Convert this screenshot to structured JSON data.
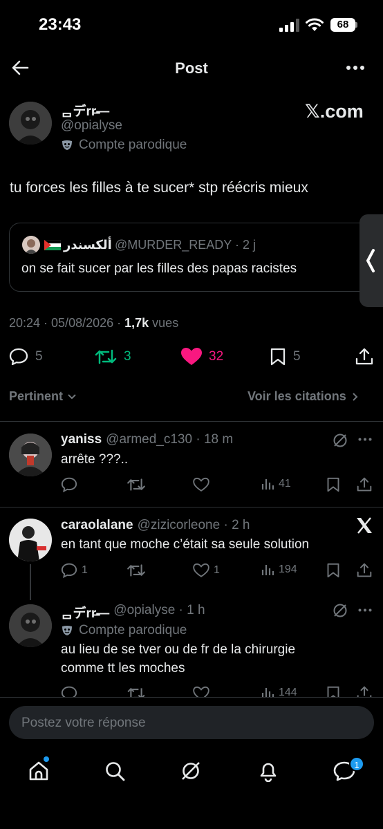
{
  "status": {
    "time": "23:43",
    "battery": "68"
  },
  "header": {
    "title": "Post"
  },
  "post": {
    "author_name": "ᆷデrr̶—",
    "handle": "@opialyse",
    "parody_label": "Compte parodique",
    "source": "𝕏.com",
    "text": "tu forces les filles à te sucer* stp réécris mieux",
    "quote": {
      "name": "ألكسندر",
      "flag": "🇵🇸",
      "handle": "@MURDER_READY · 2 j",
      "text": "on se fait sucer par les filles des papas racistes"
    },
    "timestamp": "20:24 · 05/08/2026 · ",
    "views": "1,7k",
    "views_label": " vues",
    "stats": {
      "replies": "5",
      "reposts": "3",
      "likes": "32",
      "bookmarks": "5"
    }
  },
  "sort": {
    "left": "Pertinent",
    "right": "Voir les citations"
  },
  "replies": [
    {
      "name": "yaniss",
      "handle": "@armed_c130 · 18 m",
      "text": "arrête ???..",
      "replies": "",
      "reposts": "",
      "likes": "",
      "views": "41"
    },
    {
      "name": "caraolalane",
      "handle": "@zizicorleone · 2 h",
      "text": "en tant que moche c’était sa seule solution",
      "replies": "1",
      "reposts": "",
      "likes": "1",
      "views": "194"
    },
    {
      "name": "ᆷデrr̶—",
      "handle": "@opialyse · 1 h",
      "parody_label": "Compte parodique",
      "text_line1": "au lieu de se tver ou de fr de la chirurgie",
      "text_line2": "comme tt les moches",
      "views": "144"
    }
  ],
  "compose": {
    "placeholder": "Postez votre réponse"
  },
  "nav": {
    "messages_badge": "1"
  },
  "colors": {
    "accent": "#1d9bf0",
    "like": "#f91880",
    "repost": "#00ba7c",
    "background": "#000000"
  }
}
